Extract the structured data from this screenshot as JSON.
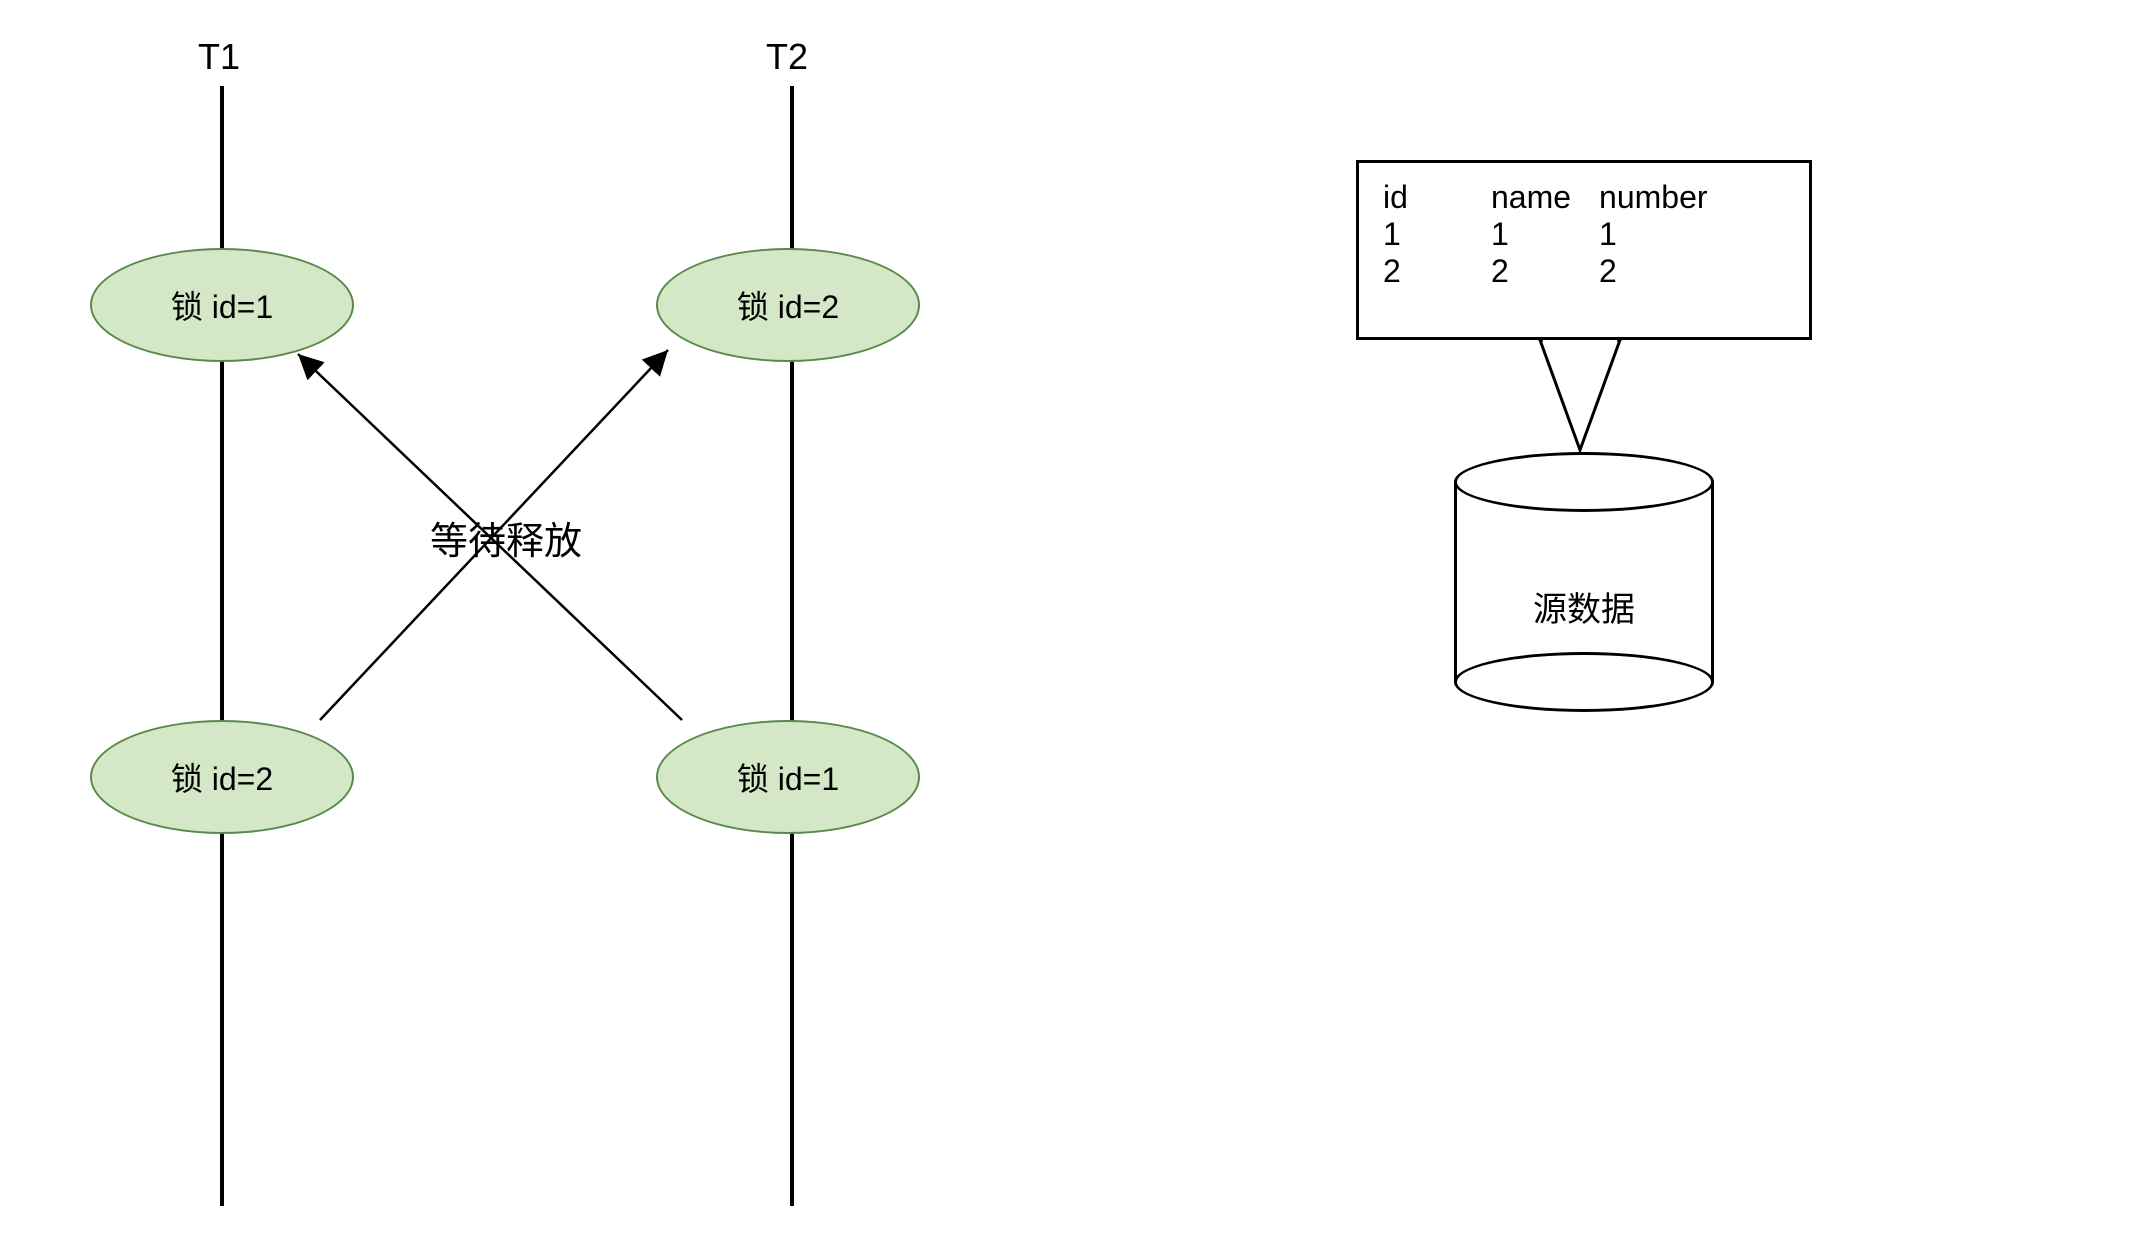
{
  "threads": {
    "t1": {
      "label": "T1"
    },
    "t2": {
      "label": "T2"
    }
  },
  "locks": {
    "t1_top": "锁 id=1",
    "t2_top": "锁 id=2",
    "t1_bottom": "锁 id=2",
    "t2_bottom": "锁 id=1"
  },
  "center_label": "等待释放",
  "data_table": {
    "headers": [
      "id",
      "name",
      "number"
    ],
    "rows": [
      [
        "1",
        "1",
        "1"
      ],
      [
        "2",
        "2",
        "2"
      ]
    ]
  },
  "cylinder_label": "源数据"
}
